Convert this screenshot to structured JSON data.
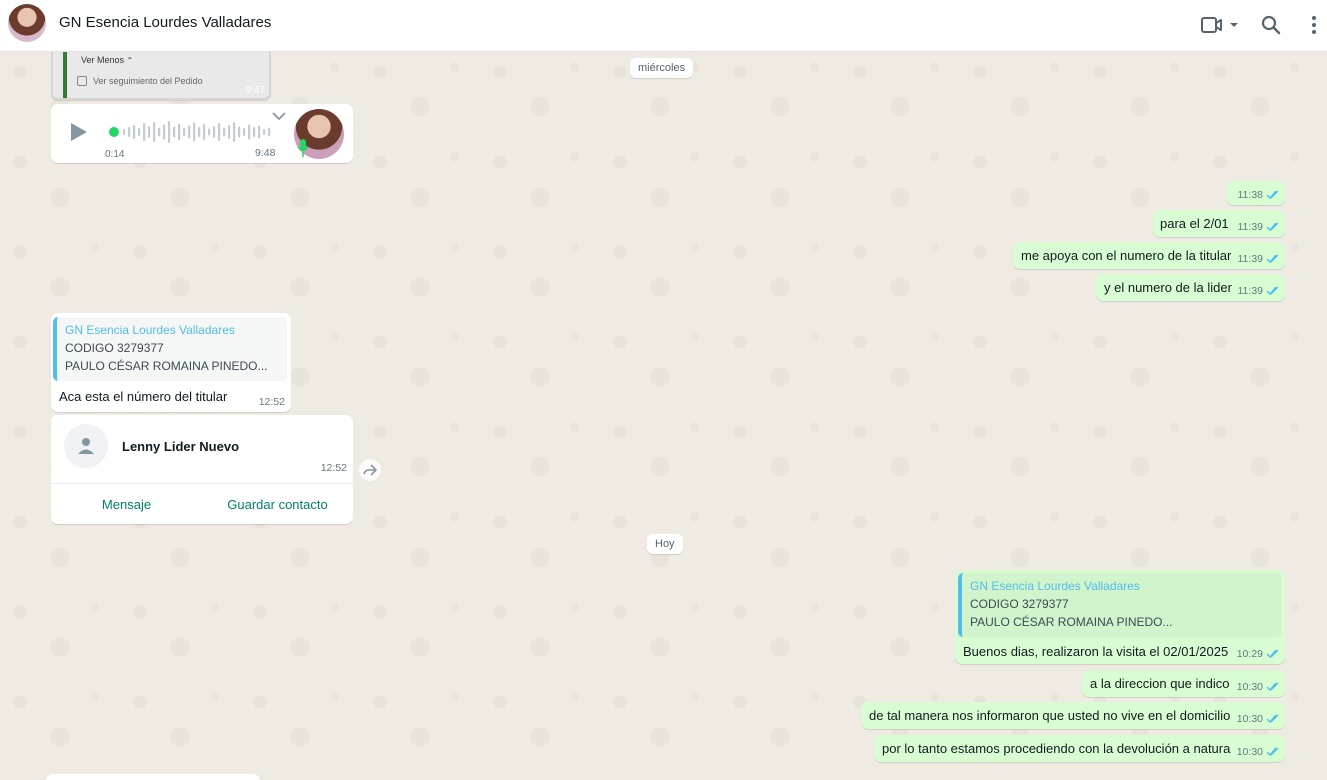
{
  "header": {
    "title": "GN Esencia Lourdes Valladares"
  },
  "colors": {
    "outgoing": "#d9fdd3",
    "incoming": "#ffffff",
    "accent": "#53bdeb",
    "green": "#25d366",
    "link": "#008069"
  },
  "card": {
    "ver_menos": "Ver Menos",
    "seguimiento": "Ver seguimiento del Pedido",
    "time": "9:47"
  },
  "audio": {
    "duration": "0:14",
    "time": "9:48"
  },
  "dates": {
    "wednesday": "miércoles",
    "today": "Hoy"
  },
  "out1": [
    {
      "text": "",
      "time": "11:38"
    },
    {
      "text": "para el 2/01",
      "time": "11:39"
    },
    {
      "text": "me apoya con el numero de la titular",
      "time": "11:39"
    },
    {
      "text": "y el numero de la lider",
      "time": "11:39"
    }
  ],
  "reply_in": {
    "quote_name": "GN Esencia Lourdes Valladares",
    "quote_line1": "CODIGO 3279377",
    "quote_line2": "PAULO CÉSAR ROMAINA PINEDO...",
    "text": "Aca esta el número del titular",
    "time": "12:52"
  },
  "contact": {
    "name": "Lenny Lider Nuevo",
    "time": "12:52",
    "message_btn": "Mensaje",
    "save_btn": "Guardar contacto"
  },
  "reply_out": {
    "quote_name": "GN Esencia Lourdes Valladares",
    "quote_line1": "CODIGO 3279377",
    "quote_line2": "PAULO CÉSAR ROMAINA PINEDO...",
    "text": "Buenos dias, realizaron la visita el 02/01/2025",
    "time": "10:29"
  },
  "out2": [
    {
      "text": "a la direccion que indico",
      "time": "10:30"
    },
    {
      "text": "de tal manera nos informaron que usted no vive en el domicilio",
      "time": "10:30"
    },
    {
      "text": "por lo tanto estamos procediendo con la devolución a natura",
      "time": "10:30"
    }
  ]
}
